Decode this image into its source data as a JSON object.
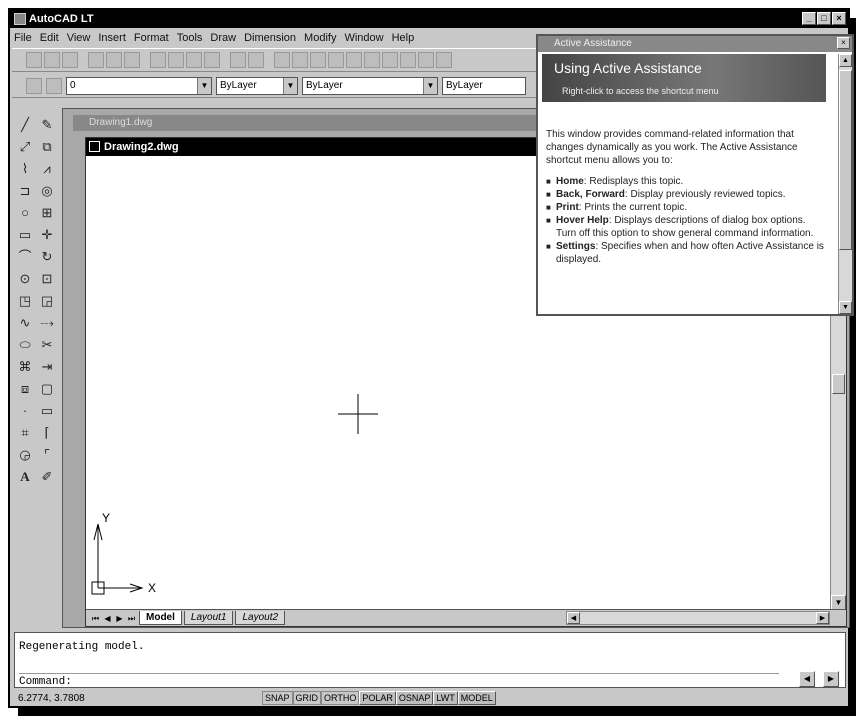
{
  "window": {
    "title": "AutoCAD LT",
    "controls": [
      "_",
      "□",
      "×"
    ]
  },
  "menu": [
    "File",
    "Edit",
    "View",
    "Insert",
    "Format",
    "Tools",
    "Draw",
    "Dimension",
    "Modify",
    "Window",
    "Help"
  ],
  "properties_bar": {
    "layer_value": "0",
    "color_value": "ByLayer",
    "linetype_value": "ByLayer",
    "lineweight_value": "ByLayer"
  },
  "drawing_windows": {
    "background_title": "Drawing1.dwg",
    "active_title": "Drawing2.dwg"
  },
  "ucs": {
    "x_label": "X",
    "y_label": "Y"
  },
  "layout_tabs": [
    "Model",
    "Layout1",
    "Layout2"
  ],
  "command": {
    "history": "Regenerating model.",
    "prompt": "Command:"
  },
  "status": {
    "coords": "6.2774, 3.7808",
    "toggles": [
      "SNAP",
      "GRID",
      "ORTHO",
      "POLAR",
      "OSNAP",
      "LWT",
      "MODEL"
    ],
    "toggles_on": [
      "POLAR",
      "OSNAP",
      "LWT",
      "MODEL"
    ]
  },
  "assist": {
    "window_title": "Active Assistance",
    "heading": "Using Active Assistance",
    "subheading": "Right-click to access the shortcut menu",
    "intro": "This window provides command-related information that changes dynamically as you work. The Active Assistance shortcut menu allows you to:",
    "items": [
      {
        "term": "Home",
        "desc": ": Redisplays this topic."
      },
      {
        "term": "Back, Forward",
        "desc": ": Display previously reviewed topics."
      },
      {
        "term": "Print",
        "desc": ": Prints the current topic."
      },
      {
        "term": "Hover Help",
        "desc": ": Displays descriptions of dialog box options. Turn off this option to show general command information."
      },
      {
        "term": "Settings",
        "desc": ": Specifies when and how often Active Assistance is displayed."
      }
    ]
  }
}
